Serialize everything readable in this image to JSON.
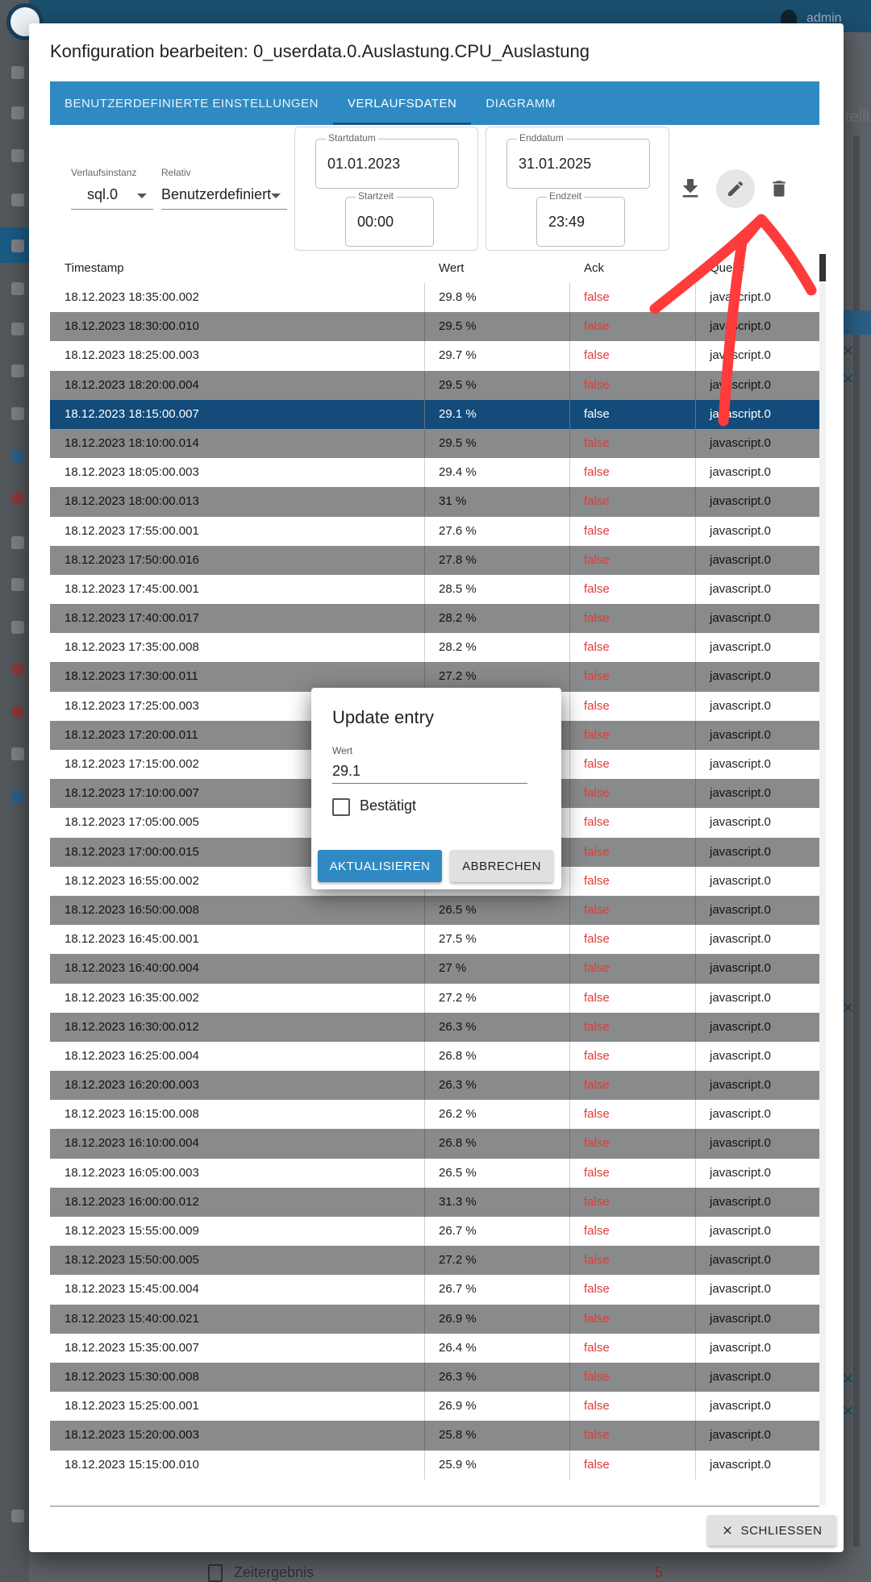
{
  "background": {
    "user": "admin",
    "footer_item": "Zeitergebnis",
    "footer_count": "5",
    "right_partial": "telli"
  },
  "modal": {
    "title": "Konfiguration bearbeiten: 0_userdata.0.Auslastung.CPU_Auslastung",
    "tabs": [
      {
        "label": "Benutzerdefinierte Einstellungen"
      },
      {
        "label": "Verlaufsdaten"
      },
      {
        "label": "Diagramm"
      }
    ],
    "filters": {
      "instance_label": "Verlaufsinstanz",
      "instance_value": "sql.0",
      "relative_label": "Relativ",
      "relative_value": "Benutzerdefiniert",
      "start_date_label": "Startdatum",
      "start_date": "01.01.2023",
      "start_time_label": "Startzeit",
      "start_time": "00:00",
      "end_date_label": "Enddatum",
      "end_date": "31.01.2025",
      "end_time_label": "Endzeit",
      "end_time": "23:49"
    },
    "table": {
      "headers": {
        "timestamp": "Timestamp",
        "value": "Wert",
        "ack": "Ack",
        "source": "Quelle"
      },
      "rows": [
        {
          "ts": "18.12.2023 18:35:00.002",
          "val": "29.8 %",
          "ack": "false",
          "src": "javascript.0"
        },
        {
          "ts": "18.12.2023 18:30:00.010",
          "val": "29.5 %",
          "ack": "false",
          "src": "javascript.0"
        },
        {
          "ts": "18.12.2023 18:25:00.003",
          "val": "29.7 %",
          "ack": "false",
          "src": "javascript.0"
        },
        {
          "ts": "18.12.2023 18:20:00.004",
          "val": "29.5 %",
          "ack": "false",
          "src": "javascript.0"
        },
        {
          "ts": "18.12.2023 18:15:00.007",
          "val": "29.1 %",
          "ack": "false",
          "src": "javascript.0"
        },
        {
          "ts": "18.12.2023 18:10:00.014",
          "val": "29.5 %",
          "ack": "false",
          "src": "javascript.0"
        },
        {
          "ts": "18.12.2023 18:05:00.003",
          "val": "29.4 %",
          "ack": "false",
          "src": "javascript.0"
        },
        {
          "ts": "18.12.2023 18:00:00.013",
          "val": "31 %",
          "ack": "false",
          "src": "javascript.0"
        },
        {
          "ts": "18.12.2023 17:55:00.001",
          "val": "27.6 %",
          "ack": "false",
          "src": "javascript.0"
        },
        {
          "ts": "18.12.2023 17:50:00.016",
          "val": "27.8 %",
          "ack": "false",
          "src": "javascript.0"
        },
        {
          "ts": "18.12.2023 17:45:00.001",
          "val": "28.5 %",
          "ack": "false",
          "src": "javascript.0"
        },
        {
          "ts": "18.12.2023 17:40:00.017",
          "val": "28.2 %",
          "ack": "false",
          "src": "javascript.0"
        },
        {
          "ts": "18.12.2023 17:35:00.008",
          "val": "28.2 %",
          "ack": "false",
          "src": "javascript.0"
        },
        {
          "ts": "18.12.2023 17:30:00.011",
          "val": "27.2 %",
          "ack": "false",
          "src": "javascript.0"
        },
        {
          "ts": "18.12.2023 17:25:00.003",
          "val": "",
          "ack": "false",
          "src": "javascript.0"
        },
        {
          "ts": "18.12.2023 17:20:00.011",
          "val": "",
          "ack": "false",
          "src": "javascript.0"
        },
        {
          "ts": "18.12.2023 17:15:00.002",
          "val": "",
          "ack": "false",
          "src": "javascript.0"
        },
        {
          "ts": "18.12.2023 17:10:00.007",
          "val": "",
          "ack": "false",
          "src": "javascript.0"
        },
        {
          "ts": "18.12.2023 17:05:00.005",
          "val": "",
          "ack": "false",
          "src": "javascript.0"
        },
        {
          "ts": "18.12.2023 17:00:00.015",
          "val": "",
          "ack": "false",
          "src": "javascript.0"
        },
        {
          "ts": "18.12.2023 16:55:00.002",
          "val": "",
          "ack": "false",
          "src": "javascript.0"
        },
        {
          "ts": "18.12.2023 16:50:00.008",
          "val": "26.5 %",
          "ack": "false",
          "src": "javascript.0"
        },
        {
          "ts": "18.12.2023 16:45:00.001",
          "val": "27.5 %",
          "ack": "false",
          "src": "javascript.0"
        },
        {
          "ts": "18.12.2023 16:40:00.004",
          "val": "27 %",
          "ack": "false",
          "src": "javascript.0"
        },
        {
          "ts": "18.12.2023 16:35:00.002",
          "val": "27.2 %",
          "ack": "false",
          "src": "javascript.0"
        },
        {
          "ts": "18.12.2023 16:30:00.012",
          "val": "26.3 %",
          "ack": "false",
          "src": "javascript.0"
        },
        {
          "ts": "18.12.2023 16:25:00.004",
          "val": "26.8 %",
          "ack": "false",
          "src": "javascript.0"
        },
        {
          "ts": "18.12.2023 16:20:00.003",
          "val": "26.3 %",
          "ack": "false",
          "src": "javascript.0"
        },
        {
          "ts": "18.12.2023 16:15:00.008",
          "val": "26.2 %",
          "ack": "false",
          "src": "javascript.0"
        },
        {
          "ts": "18.12.2023 16:10:00.004",
          "val": "26.8 %",
          "ack": "false",
          "src": "javascript.0"
        },
        {
          "ts": "18.12.2023 16:05:00.003",
          "val": "26.5 %",
          "ack": "false",
          "src": "javascript.0"
        },
        {
          "ts": "18.12.2023 16:00:00.012",
          "val": "31.3 %",
          "ack": "false",
          "src": "javascript.0"
        },
        {
          "ts": "18.12.2023 15:55:00.009",
          "val": "26.7 %",
          "ack": "false",
          "src": "javascript.0"
        },
        {
          "ts": "18.12.2023 15:50:00.005",
          "val": "27.2 %",
          "ack": "false",
          "src": "javascript.0"
        },
        {
          "ts": "18.12.2023 15:45:00.004",
          "val": "26.7 %",
          "ack": "false",
          "src": "javascript.0"
        },
        {
          "ts": "18.12.2023 15:40:00.021",
          "val": "26.9 %",
          "ack": "false",
          "src": "javascript.0"
        },
        {
          "ts": "18.12.2023 15:35:00.007",
          "val": "26.4 %",
          "ack": "false",
          "src": "javascript.0"
        },
        {
          "ts": "18.12.2023 15:30:00.008",
          "val": "26.3 %",
          "ack": "false",
          "src": "javascript.0"
        },
        {
          "ts": "18.12.2023 15:25:00.001",
          "val": "26.9 %",
          "ack": "false",
          "src": "javascript.0"
        },
        {
          "ts": "18.12.2023 15:20:00.003",
          "val": "25.8 %",
          "ack": "false",
          "src": "javascript.0"
        },
        {
          "ts": "18.12.2023 15:15:00.010",
          "val": "25.9 %",
          "ack": "false",
          "src": "javascript.0"
        }
      ],
      "selected_index": 4
    },
    "close_label": "SCHLIESSEN"
  },
  "dialog": {
    "title": "Update entry",
    "value_label": "Wert",
    "value": "29.1",
    "confirmed_label": "Bestätigt",
    "update_label": "AKTUALISIEREN",
    "cancel_label": "ABBRECHEN"
  },
  "colors": {
    "accent": "#2f8ac4",
    "selected_row": "#134b7a",
    "ack_false": "#e53935",
    "annotation_arrow": "#ff3b3b"
  }
}
